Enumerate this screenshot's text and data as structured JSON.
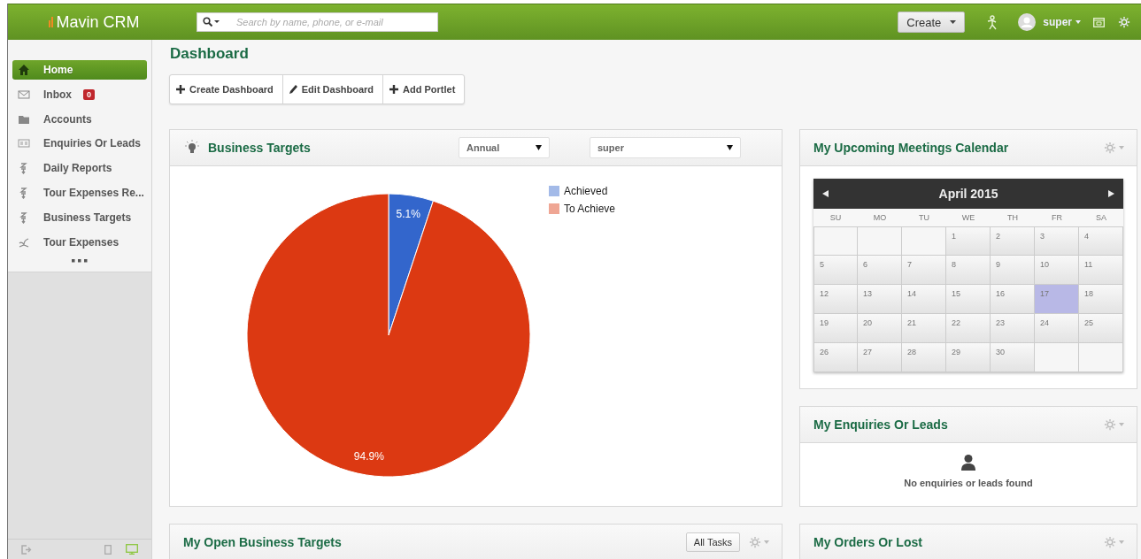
{
  "topbar": {
    "logo": "Mavin CRM",
    "search": {
      "placeholder": "Search by name, phone, or e-mail"
    },
    "create_button": "Create",
    "user": "super"
  },
  "sidebar": {
    "items": [
      {
        "label": "Home",
        "selected": true
      },
      {
        "label": "Inbox",
        "selected": false,
        "badge": "0"
      },
      {
        "label": "Accounts",
        "selected": false
      },
      {
        "label": "Enquiries Or Leads",
        "selected": false
      },
      {
        "label": "Daily Reports",
        "selected": false
      },
      {
        "label": "Tour Expenses Re...",
        "selected": false
      },
      {
        "label": "Business Targets",
        "selected": false
      },
      {
        "label": "Tour Expenses",
        "selected": false
      }
    ],
    "view_modes": [
      {
        "selected": false
      },
      {
        "selected": true
      }
    ]
  },
  "page_title": "Dashboard",
  "toolbar": [
    "Create Dashboard",
    "Edit Dashboard",
    "Add Portlet"
  ],
  "business_targets": {
    "title": "Business Targets",
    "period": "Annual",
    "user": "super",
    "chart_data": {
      "type": "pie",
      "categories": [
        "Achieved",
        "To Achieve"
      ],
      "values": [
        5.1,
        94.9
      ],
      "colors": [
        "#3366cc",
        "#dc3912"
      ],
      "value_labels": [
        "5.1%",
        "94.9%"
      ]
    }
  },
  "open_business_targets": {
    "title": "My Open Business Targets",
    "button": "All Tasks"
  },
  "meetings_calendar": {
    "title": "My Upcoming Meetings Calendar",
    "month": "April 2015",
    "weekdays": [
      "SU",
      "MO",
      "TU",
      "WE",
      "TH",
      "FR",
      "SA"
    ],
    "weeks": [
      [
        {
          "kind": "blank"
        },
        {
          "kind": "blank"
        },
        {
          "kind": "blank"
        },
        {
          "day": "1",
          "selected": false
        },
        {
          "day": "2",
          "selected": false
        },
        {
          "day": "3",
          "selected": false
        },
        {
          "day": "4",
          "selected": false
        }
      ],
      [
        {
          "day": "5",
          "selected": false
        },
        {
          "day": "6",
          "selected": false
        },
        {
          "day": "7",
          "selected": false
        },
        {
          "day": "8",
          "selected": false
        },
        {
          "day": "9",
          "selected": false
        },
        {
          "day": "10",
          "selected": false
        },
        {
          "day": "11",
          "selected": false
        }
      ],
      [
        {
          "day": "12",
          "selected": false
        },
        {
          "day": "13",
          "selected": false
        },
        {
          "day": "14",
          "selected": false
        },
        {
          "day": "15",
          "selected": false
        },
        {
          "day": "16",
          "selected": false
        },
        {
          "day": "17",
          "selected": true
        },
        {
          "day": "18",
          "selected": false
        }
      ],
      [
        {
          "day": "19",
          "selected": false
        },
        {
          "day": "20",
          "selected": false
        },
        {
          "day": "21",
          "selected": false
        },
        {
          "day": "22",
          "selected": false
        },
        {
          "day": "23",
          "selected": false
        },
        {
          "day": "24",
          "selected": false
        },
        {
          "day": "25",
          "selected": false
        }
      ],
      [
        {
          "day": "26",
          "selected": false
        },
        {
          "day": "27",
          "selected": false
        },
        {
          "day": "28",
          "selected": false
        },
        {
          "day": "29",
          "selected": false
        },
        {
          "day": "30",
          "selected": false
        },
        {
          "kind": "blank"
        },
        {
          "kind": "blank"
        }
      ]
    ]
  },
  "enquiries": {
    "title": "My Enquiries Or Leads",
    "empty_message": "No enquiries or leads found"
  },
  "orders": {
    "title": "My Orders Or Lost"
  }
}
